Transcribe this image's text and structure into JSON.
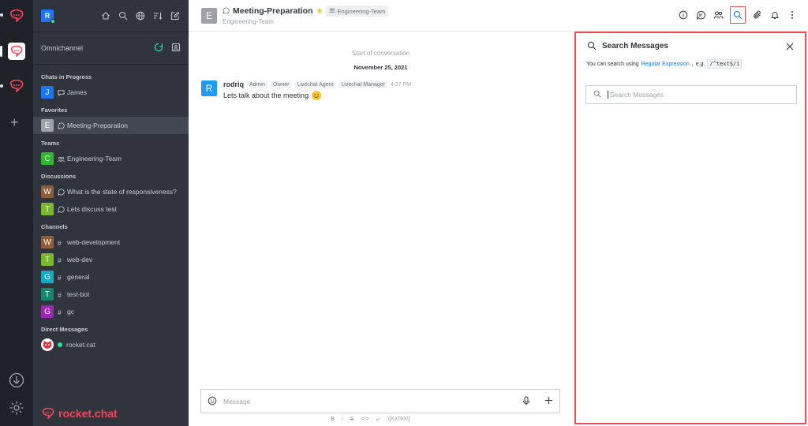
{
  "workspace": {
    "brand": "rocket.chat"
  },
  "sidebar": {
    "user_initial": "R",
    "omnichannel_label": "Omnichannel",
    "sections": {
      "chats_in_progress": "Chats in Progress",
      "favorites": "Favorites",
      "teams": "Teams",
      "discussions": "Discussions",
      "channels": "Channels",
      "direct_messages": "Direct Messages"
    },
    "chats": [
      {
        "initial": "J",
        "name": "James",
        "color": "#1d74f5"
      }
    ],
    "favorites": [
      {
        "initial": "E",
        "name": "Meeting-Preparation",
        "color": "#9ea2a8"
      }
    ],
    "teams": [
      {
        "initial": "C",
        "name": "Engineering-Team",
        "color": "#2eb82e"
      }
    ],
    "discussions": [
      {
        "initial": "W",
        "name": "What is the state of responsiveness?",
        "color": "#8d5e3c"
      },
      {
        "initial": "T",
        "name": "Lets discuss test",
        "color": "#7cb82e"
      }
    ],
    "channels": [
      {
        "initial": "W",
        "name": "web-development",
        "color": "#8d5e3c"
      },
      {
        "initial": "T",
        "name": "web-dev",
        "color": "#7cb82e"
      },
      {
        "initial": "G",
        "name": "general",
        "color": "#16a8c4"
      },
      {
        "initial": "T",
        "name": "test-bot",
        "color": "#15876b"
      },
      {
        "initial": "G",
        "name": "gc",
        "color": "#9c27b0"
      }
    ],
    "direct_messages": [
      {
        "name": "rocket.cat"
      }
    ]
  },
  "header": {
    "room_initial": "E",
    "room_name": "Meeting-Preparation",
    "team_tag": "Engineering-Team",
    "subtitle": "Engineering-Team"
  },
  "conversation": {
    "start_label": "Start of conversation",
    "date": "November 25, 2021",
    "message": {
      "initial": "R",
      "user": "rodriq",
      "roles": [
        "Admin",
        "Owner",
        "Livechat Agent",
        "Livechat Manager"
      ],
      "time": "4:37 PM",
      "text": "Lets talk about the meeting"
    }
  },
  "composer": {
    "placeholder": "Message",
    "formatting": [
      "B",
      "i",
      "S",
      "</>",
      "↵",
      "\\[KaTeX\\]"
    ]
  },
  "search_panel": {
    "title": "Search Messages",
    "hint_prefix": "You can search using",
    "hint_link": "Regular Expression",
    "hint_mid": "e.g.",
    "hint_example": "/^text$/i",
    "input_placeholder": "Search Messages"
  },
  "colors": {
    "accent": "#1d74f5",
    "highlight": "#ec4e53",
    "sidebar_bg": "#2f343d",
    "rail_bg": "#1f2329"
  }
}
